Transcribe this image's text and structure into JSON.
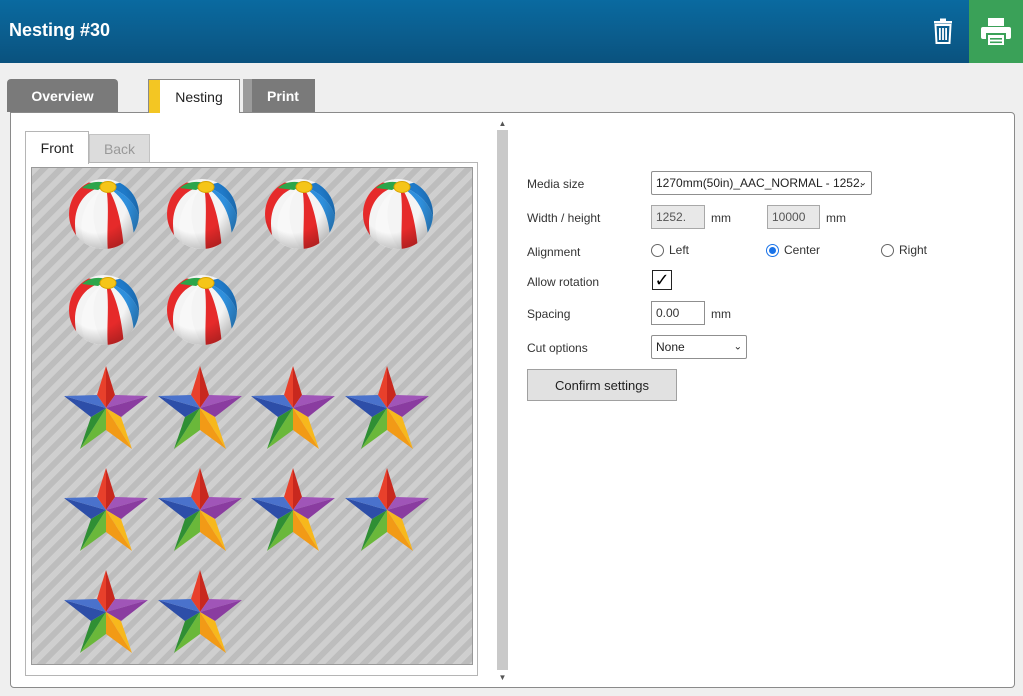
{
  "header": {
    "title": "Nesting #30"
  },
  "tabs": {
    "overview": "Overview",
    "nesting": "Nesting",
    "print": "Print"
  },
  "subtabs": {
    "front": "Front",
    "back": "Back"
  },
  "form": {
    "media_size_label": "Media size",
    "media_size_value": "1270mm(50in)_AAC_NORMAL - 1252.",
    "width_height_label": "Width / height",
    "width_value": "1252.",
    "height_value": "10000",
    "unit": "mm",
    "alignment_label": "Alignment",
    "alignment_options": [
      "Left",
      "Center",
      "Right"
    ],
    "alignment_selected": "Center",
    "allow_rotation_label": "Allow rotation",
    "allow_rotation_checked": true,
    "check_glyph": "✓",
    "spacing_label": "Spacing",
    "spacing_value": "0.00",
    "cut_options_label": "Cut options",
    "cut_options_value": "None",
    "confirm_label": "Confirm settings"
  },
  "layout_items": {
    "beach_balls": 6,
    "stars": 10
  },
  "colors": {
    "header": "#0b5c8c",
    "print_button": "#3aa158",
    "tab_accent": "#f3c623",
    "radio_selected": "#1a73e8"
  }
}
